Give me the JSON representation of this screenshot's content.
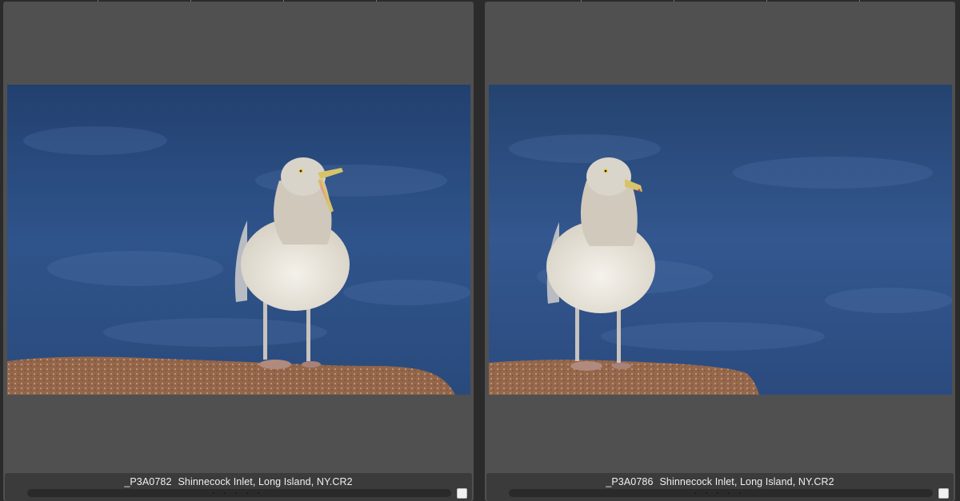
{
  "panes": [
    {
      "filename": "_P3A0782",
      "caption": "Shinnecock Inlet, Long Island, NY.CR2",
      "image_subject": "herring gull on rock, beak open, calling",
      "selected": false
    },
    {
      "filename": "_P3A0786",
      "caption": "Shinnecock Inlet, Long Island, NY.CR2",
      "image_subject": "herring gull on rock, beak closed",
      "selected": false
    }
  ],
  "colors": {
    "pane_bg": "#505050",
    "footer_bg": "#3b3b3b",
    "water_blue": "#2e4f84",
    "rock": "#9a6a4c"
  }
}
